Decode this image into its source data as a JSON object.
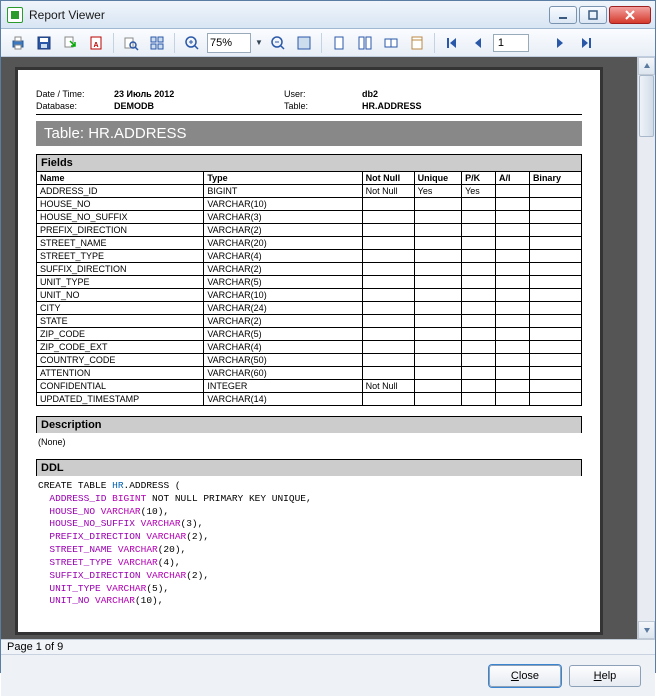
{
  "window": {
    "title": "Report Viewer"
  },
  "toolbar": {
    "zoom": "75%",
    "page_value": "1"
  },
  "status": {
    "text": "Page 1 of 9"
  },
  "buttons": {
    "close": "Close",
    "help": "Help"
  },
  "report": {
    "meta": {
      "date_label": "Date / Time:",
      "date_value": "23 Июль 2012",
      "user_label": "User:",
      "user_value": "db2",
      "db_label": "Database:",
      "db_value": "DEMODB",
      "table_label": "Table:",
      "table_value": "HR.ADDRESS"
    },
    "title": "Table: HR.ADDRESS",
    "fields_header": "Fields",
    "columns": {
      "name": "Name",
      "type": "Type",
      "not_null": "Not Null",
      "unique": "Unique",
      "pk": "P/K",
      "ai": "A/I",
      "binary": "Binary"
    },
    "rows": [
      {
        "name": "ADDRESS_ID",
        "type": "BIGINT",
        "not_null": "Not Null",
        "unique": "Yes",
        "pk": "Yes",
        "ai": "",
        "binary": ""
      },
      {
        "name": "HOUSE_NO",
        "type": "VARCHAR(10)",
        "not_null": "",
        "unique": "",
        "pk": "",
        "ai": "",
        "binary": ""
      },
      {
        "name": "HOUSE_NO_SUFFIX",
        "type": "VARCHAR(3)",
        "not_null": "",
        "unique": "",
        "pk": "",
        "ai": "",
        "binary": ""
      },
      {
        "name": "PREFIX_DIRECTION",
        "type": "VARCHAR(2)",
        "not_null": "",
        "unique": "",
        "pk": "",
        "ai": "",
        "binary": ""
      },
      {
        "name": "STREET_NAME",
        "type": "VARCHAR(20)",
        "not_null": "",
        "unique": "",
        "pk": "",
        "ai": "",
        "binary": ""
      },
      {
        "name": "STREET_TYPE",
        "type": "VARCHAR(4)",
        "not_null": "",
        "unique": "",
        "pk": "",
        "ai": "",
        "binary": ""
      },
      {
        "name": "SUFFIX_DIRECTION",
        "type": "VARCHAR(2)",
        "not_null": "",
        "unique": "",
        "pk": "",
        "ai": "",
        "binary": ""
      },
      {
        "name": "UNIT_TYPE",
        "type": "VARCHAR(5)",
        "not_null": "",
        "unique": "",
        "pk": "",
        "ai": "",
        "binary": ""
      },
      {
        "name": "UNIT_NO",
        "type": "VARCHAR(10)",
        "not_null": "",
        "unique": "",
        "pk": "",
        "ai": "",
        "binary": ""
      },
      {
        "name": "CITY",
        "type": "VARCHAR(24)",
        "not_null": "",
        "unique": "",
        "pk": "",
        "ai": "",
        "binary": ""
      },
      {
        "name": "STATE",
        "type": "VARCHAR(2)",
        "not_null": "",
        "unique": "",
        "pk": "",
        "ai": "",
        "binary": ""
      },
      {
        "name": "ZIP_CODE",
        "type": "VARCHAR(5)",
        "not_null": "",
        "unique": "",
        "pk": "",
        "ai": "",
        "binary": ""
      },
      {
        "name": "ZIP_CODE_EXT",
        "type": "VARCHAR(4)",
        "not_null": "",
        "unique": "",
        "pk": "",
        "ai": "",
        "binary": ""
      },
      {
        "name": "COUNTRY_CODE",
        "type": "VARCHAR(50)",
        "not_null": "",
        "unique": "",
        "pk": "",
        "ai": "",
        "binary": ""
      },
      {
        "name": "ATTENTION",
        "type": "VARCHAR(60)",
        "not_null": "",
        "unique": "",
        "pk": "",
        "ai": "",
        "binary": ""
      },
      {
        "name": "CONFIDENTIAL",
        "type": "INTEGER",
        "not_null": "Not Null",
        "unique": "",
        "pk": "",
        "ai": "",
        "binary": ""
      },
      {
        "name": "UPDATED_TIMESTAMP",
        "type": "VARCHAR(14)",
        "not_null": "",
        "unique": "",
        "pk": "",
        "ai": "",
        "binary": ""
      }
    ],
    "description_header": "Description",
    "description_body": "(None)",
    "ddl_header": "DDL",
    "ddl": {
      "l0a": "CREATE TABLE ",
      "l0b": "HR",
      "l0c": ".ADDRESS (",
      "l1a": "ADDRESS_ID",
      "l1b": " BIGINT",
      "l1c": " NOT NULL PRIMARY KEY UNIQUE,",
      "l2a": "HOUSE_NO",
      "l2b": " VARCHAR",
      "l2c": "(10),",
      "l3a": "HOUSE_NO_SUFFIX",
      "l3b": " VARCHAR",
      "l3c": "(3),",
      "l4a": "PREFIX_DIRECTION",
      "l4b": " VARCHAR",
      "l4c": "(2),",
      "l5a": "STREET_NAME",
      "l5b": " VARCHAR",
      "l5c": "(20),",
      "l6a": "STREET_TYPE",
      "l6b": " VARCHAR",
      "l6c": "(4),",
      "l7a": "SUFFIX_DIRECTION",
      "l7b": " VARCHAR",
      "l7c": "(2),",
      "l8a": "UNIT_TYPE",
      "l8b": " VARCHAR",
      "l8c": "(5),",
      "l9a": "UNIT_NO",
      "l9b": " VARCHAR",
      "l9c": "(10),"
    }
  }
}
